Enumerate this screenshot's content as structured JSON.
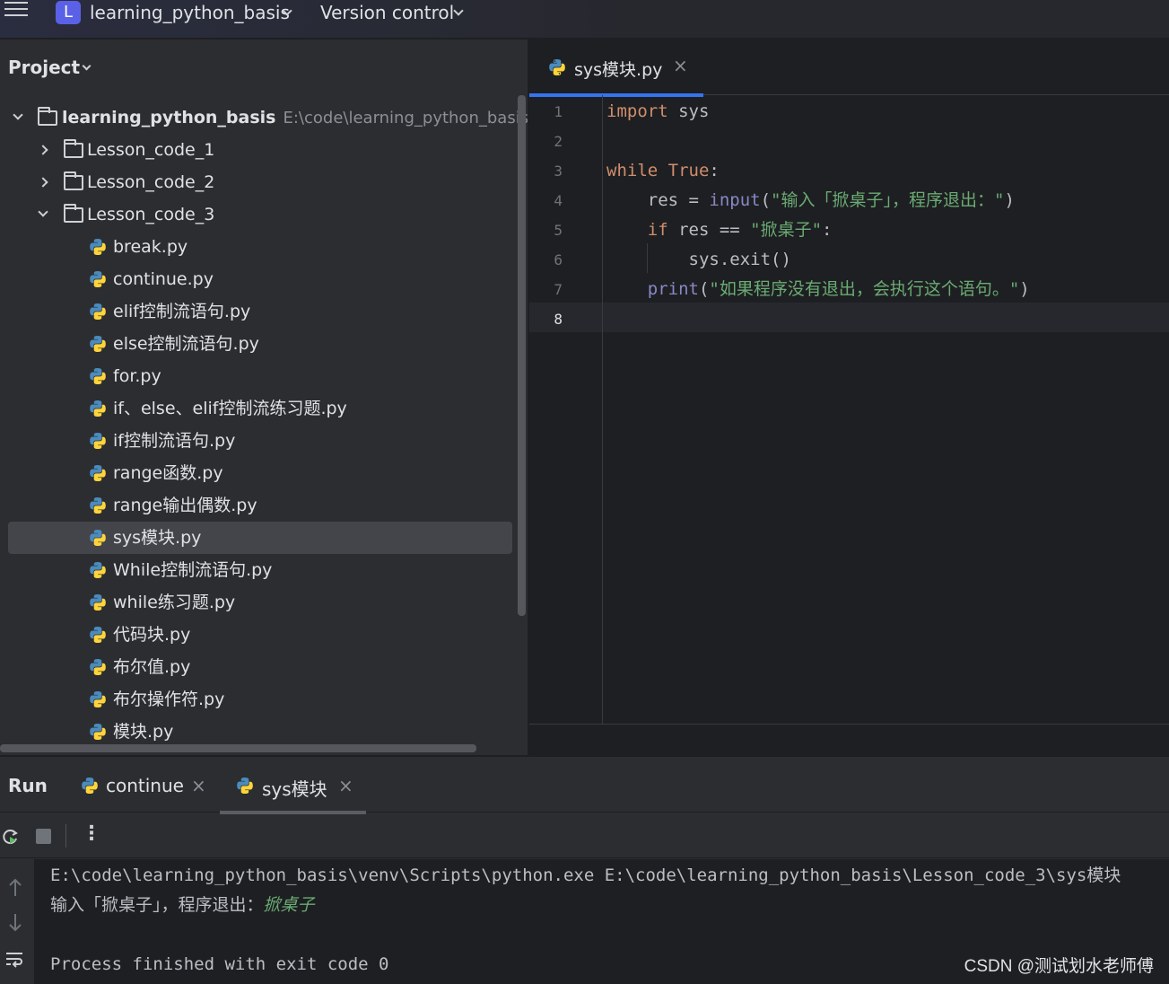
{
  "titlebar": {
    "project_initial": "L",
    "project_name": "learning_python_basis",
    "vcs_label": "Version control"
  },
  "project_panel": {
    "title": "Project",
    "root": {
      "name": "learning_python_basis",
      "path": "E:\\code\\learning_python_basis"
    },
    "folders": [
      "Lesson_code_1",
      "Lesson_code_2",
      "Lesson_code_3"
    ],
    "files": [
      "break.py",
      "continue.py",
      "elif控制流语句.py",
      "else控制流语句.py",
      "for.py",
      "if、else、elif控制流练习题.py",
      "if控制流语句.py",
      "range函数.py",
      "range输出偶数.py",
      "sys模块.py",
      "While控制流语句.py",
      "while练习题.py",
      "代码块.py",
      "布尔值.py",
      "布尔操作符.py",
      "模块.py"
    ],
    "selected_file": "sys模块.py"
  },
  "editor": {
    "tab_label": "sys模块.py",
    "tab_close": "×",
    "line_numbers": [
      "1",
      "2",
      "3",
      "4",
      "5",
      "6",
      "7",
      "8"
    ],
    "current_line": "8",
    "code": {
      "l1_kw": "import",
      "l1_rest": " sys",
      "l3_kw1": "while",
      "l3_sp": " ",
      "l3_kw2": "True",
      "l3_rest": ":",
      "l4_a": "    res = ",
      "l4_fn": "input",
      "l4_b": "(",
      "l4_str": "\"输入「掀桌子」，程序退出：\"",
      "l4_c": ")",
      "l5_kw": "    if",
      "l5_a": " res == ",
      "l5_str": "\"掀桌子\"",
      "l5_b": ":",
      "l6": "        sys.exit()",
      "l7_fn": "    print",
      "l7_a": "(",
      "l7_str": "\"如果程序没有退出，会执行这个语句。\"",
      "l7_b": ")"
    }
  },
  "run_panel": {
    "title": "Run",
    "tabs": [
      {
        "label": "continue",
        "close": "×"
      },
      {
        "label": "sys模块",
        "close": "×"
      }
    ],
    "more": "⋮",
    "console": {
      "command": "E:\\code\\learning_python_basis\\venv\\Scripts\\python.exe E:\\code\\learning_python_basis\\Lesson_code_3\\sys模块",
      "prompt": "输入「掀桌子」，程序退出：",
      "user_input": "掀桌子",
      "exit_message": "Process finished with exit code 0"
    }
  },
  "watermark": "CSDN @测试划水老师傅",
  "colors": {
    "accent": "#3574f0",
    "keyword": "#cf8e6d",
    "string": "#6aab73",
    "builtin": "#8888c6",
    "project_badge": "#5b61e6"
  }
}
